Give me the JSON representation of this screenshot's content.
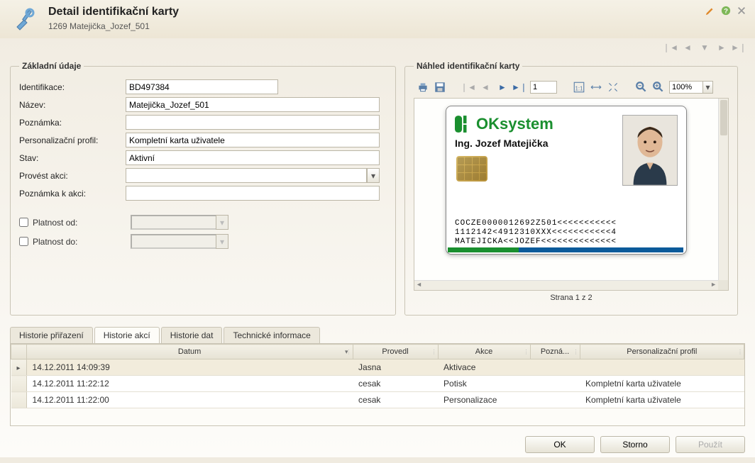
{
  "header": {
    "title": "Detail identifikační karty",
    "subtitle": "1269 Matejička_Jozef_501"
  },
  "leftPanel": {
    "legend": "Základní údaje",
    "labels": {
      "ident": "Identifikace:",
      "nazev": "Název:",
      "poznamka": "Poznámka:",
      "profil": "Personalizační profil:",
      "stav": "Stav:",
      "akce": "Provést akci:",
      "poznamkaAkce": "Poznámka k akci:",
      "platnostOd": "Platnost od:",
      "platnostDo": "Platnost do:"
    },
    "values": {
      "ident": "BD497384",
      "nazev": "Matejička_Jozef_501",
      "poznamka": "",
      "profil": "Kompletní karta uživatele",
      "stav": "Aktivní",
      "akce": "",
      "poznamkaAkce": "",
      "platnostOd": "",
      "platnostDo": ""
    }
  },
  "rightPanel": {
    "legend": "Náhled identifikační karty",
    "toolbar": {
      "page": "1",
      "zoom": "100%"
    },
    "card": {
      "brand": "OKsystem",
      "name": "Ing. Jozef Matejička",
      "mrz1": "COCZE0000012692Z501<<<<<<<<<<<",
      "mrz2": "1112142<4912310XXX<<<<<<<<<<<4",
      "mrz3": "MATEJICKA<<JOZEF<<<<<<<<<<<<<<"
    },
    "pageIndicator": "Strana 1 z 2"
  },
  "tabs": {
    "items": [
      "Historie přiřazení",
      "Historie akcí",
      "Historie dat",
      "Technické informace"
    ],
    "activeIndex": 1
  },
  "grid": {
    "columns": [
      "Datum",
      "Provedl",
      "Akce",
      "Pozná...",
      "Personalizační profil"
    ],
    "rows": [
      {
        "datum": "14.12.2011 14:09:39",
        "provedl": "Jasna",
        "akce": "Aktivace",
        "pozn": "",
        "profil": ""
      },
      {
        "datum": "14.12.2011 11:22:12",
        "provedl": "cesak",
        "akce": "Potisk",
        "pozn": "",
        "profil": "Kompletní karta uživatele"
      },
      {
        "datum": "14.12.2011 11:22:00",
        "provedl": "cesak",
        "akce": "Personalizace",
        "pozn": "",
        "profil": "Kompletní karta uživatele"
      }
    ]
  },
  "buttons": {
    "ok": "OK",
    "cancel": "Storno",
    "apply": "Použít"
  }
}
